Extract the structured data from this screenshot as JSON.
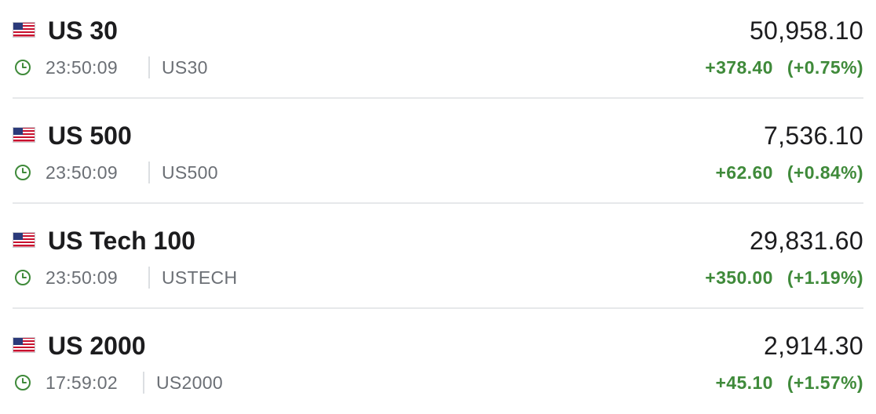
{
  "colors": {
    "positive": "#3f8a3a",
    "muted_text": "#6b6f75",
    "primary_text": "#1c1c1e",
    "divider": "#e6e8ea"
  },
  "icons": {
    "flag": "us-flag-icon",
    "clock": "clock-icon"
  },
  "indices": [
    {
      "name": "US 30",
      "price": "50,958.10",
      "time": "23:50:09",
      "symbol": "US30",
      "change": "+378.40",
      "change_pct": "(+0.75%)"
    },
    {
      "name": "US 500",
      "price": "7,536.10",
      "time": "23:50:09",
      "symbol": "US500",
      "change": "+62.60",
      "change_pct": "(+0.84%)"
    },
    {
      "name": "US Tech 100",
      "price": "29,831.60",
      "time": "23:50:09",
      "symbol": "USTECH",
      "change": "+350.00",
      "change_pct": "(+1.19%)"
    },
    {
      "name": "US 2000",
      "price": "2,914.30",
      "time": "17:59:02",
      "symbol": "US2000",
      "change": "+45.10",
      "change_pct": "(+1.57%)"
    }
  ]
}
